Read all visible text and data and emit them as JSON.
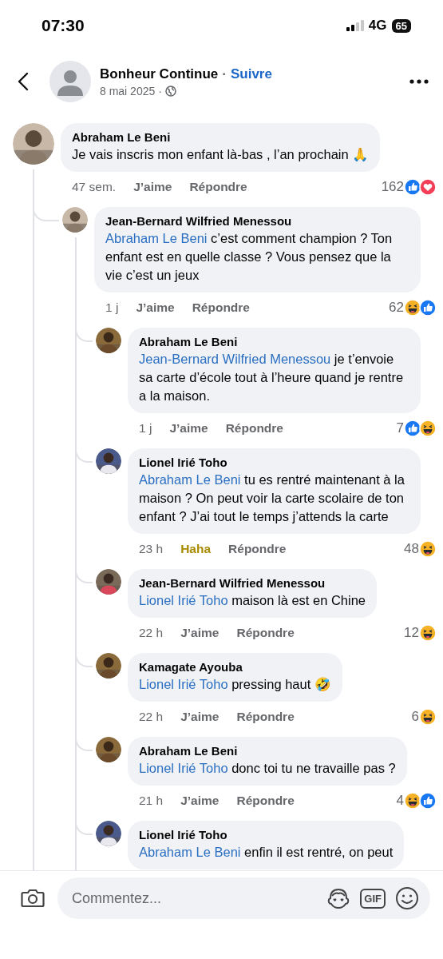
{
  "status_bar": {
    "time": "07:30",
    "network": "4G",
    "battery": "65"
  },
  "post_header": {
    "author": "Bonheur Continue",
    "separator": "·",
    "follow": "Suivre",
    "date": "8 mai 2025",
    "date_separator": "·"
  },
  "comments": [
    {
      "author": "Abraham Le Beni",
      "text": "Je vais inscris mon enfant là-bas , l’an prochain 🙏",
      "time": "47 sem.",
      "like": {
        "label": "J’aime",
        "reacted": false
      },
      "reply": "Répondre",
      "count": "162",
      "reactions": [
        {
          "kind": "like"
        },
        {
          "kind": "love"
        }
      ],
      "children": [
        {
          "author": "Jean-Bernard Wilfried Menessou",
          "mention": "Abraham Le Beni",
          "text": "c’est comment champion ? Ton enfant est en quelle classe ? Vous pensez que la vie c’est un jeux",
          "time": "1 j",
          "like": {
            "label": "J’aime",
            "reacted": false
          },
          "reply": "Répondre",
          "count": "62",
          "reactions": [
            {
              "kind": "haha"
            },
            {
              "kind": "like"
            }
          ],
          "children": [
            {
              "author": "Abraham Le Beni",
              "mention": "Jean-Bernard Wilfried Menessou",
              "text": "je t’envoie sa carte d’école tout à l’heure quand je rentre a la maison.",
              "time": "1 j",
              "like": {
                "label": "J’aime",
                "reacted": false
              },
              "reply": "Répondre",
              "count": "7",
              "reactions": [
                {
                  "kind": "like"
                },
                {
                  "kind": "haha"
                }
              ]
            },
            {
              "author": "Lionel Irié Toho",
              "mention": "Abraham Le Beni",
              "text": "tu es rentré maintenant à la maison ? On peut voir la carte scolaire de ton enfant ? J’ai tout le temps j’attends la carte",
              "time": "23 h",
              "like": {
                "label": "Haha",
                "reacted": true
              },
              "reply": "Répondre",
              "count": "48",
              "reactions": [
                {
                  "kind": "haha"
                }
              ]
            },
            {
              "author": "Jean-Bernard Wilfried Menessou",
              "mention": "Lionel Irié Toho",
              "text": "maison là est en Chine",
              "time": "22 h",
              "like": {
                "label": "J’aime",
                "reacted": false
              },
              "reply": "Répondre",
              "count": "12",
              "reactions": [
                {
                  "kind": "haha"
                }
              ]
            },
            {
              "author": "Kamagate Ayouba",
              "mention": "Lionel Irié Toho",
              "text": "pressing haut 🤣",
              "time": "22 h",
              "like": {
                "label": "J’aime",
                "reacted": false
              },
              "reply": "Répondre",
              "count": "6",
              "reactions": [
                {
                  "kind": "haha"
                }
              ]
            },
            {
              "author": "Abraham Le Beni",
              "mention": "Lionel Irié Toho",
              "text": "donc toi tu ne travaille pas ?",
              "time": "21 h",
              "like": {
                "label": "J’aime",
                "reacted": false
              },
              "reply": "Répondre",
              "count": "4",
              "reactions": [
                {
                  "kind": "haha"
                },
                {
                  "kind": "like"
                }
              ]
            },
            {
              "author": "Lionel Irié Toho",
              "mention": "Abraham Le Beni",
              "text": "enfin il est rentré, on peut"
            }
          ]
        }
      ]
    }
  ],
  "comment_bar": {
    "placeholder": "Commentez...",
    "gif": "GIF"
  }
}
